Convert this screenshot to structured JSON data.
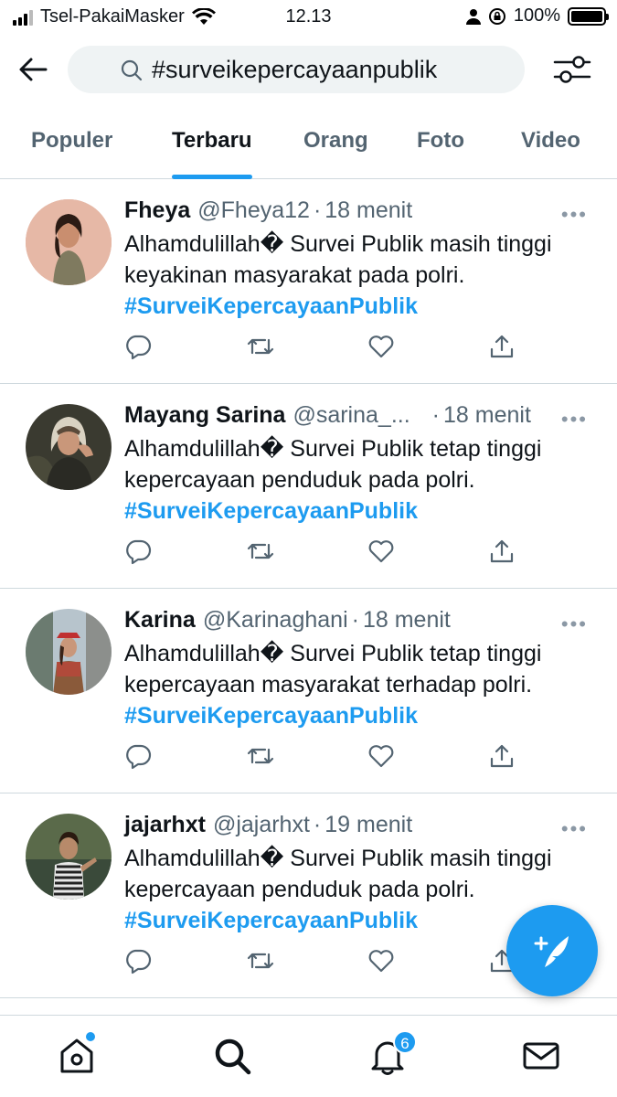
{
  "status_bar": {
    "carrier": "Tsel-PakaiMasker",
    "time": "12.13",
    "battery": "100%",
    "battery_level": 1.0
  },
  "header": {
    "search_query": "#surveikepercayaanpublik"
  },
  "tabs": [
    {
      "label": "Populer",
      "active": false
    },
    {
      "label": "Terbaru",
      "active": true
    },
    {
      "label": "Orang",
      "active": false
    },
    {
      "label": "Foto",
      "active": false
    },
    {
      "label": "Video",
      "active": false
    }
  ],
  "tweets": [
    {
      "name": "Fheya",
      "handle": "@Fheya12",
      "time": "18 menit",
      "text_line1": "Alhamdulillah� Survei Publik masih tinggi",
      "text_line2": "keyakinan masyarakat pada polri.",
      "hashtag": "#SurveiKepercayaanPublik"
    },
    {
      "name": "Mayang Sarina",
      "handle": "@sarina_...",
      "time": "18 menit",
      "text_line1": "Alhamdulillah� Survei Publik tetap tinggi",
      "text_line2": "kepercayaan penduduk pada polri.",
      "hashtag": "#SurveiKepercayaanPublik"
    },
    {
      "name": "Karina",
      "handle": "@Karinaghani",
      "time": "18 menit",
      "text_line1": "Alhamdulillah� Survei Publik tetap tinggi",
      "text_line2": "kepercayaan masyarakat terhadap polri.",
      "hashtag": "#SurveiKepercayaanPublik"
    },
    {
      "name": "jajarhxt",
      "handle": "@jajarhxt",
      "time": "19 menit",
      "text_line1": "Alhamdulillah� Survei Publik masih tinggi",
      "text_line2": "kepercayaan penduduk pada polri.",
      "hashtag": "#SurveiKepercayaanPublik"
    }
  ],
  "bottom_nav": {
    "notification_count": "6"
  },
  "colors": {
    "accent": "#1d9bf0",
    "text": "#0f1419",
    "secondary": "#536471"
  }
}
